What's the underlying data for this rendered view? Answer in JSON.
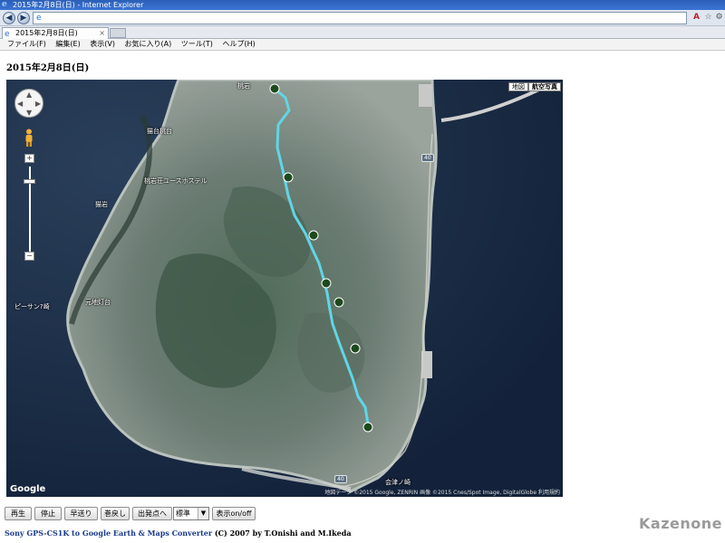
{
  "window": {
    "title": "2015年2月8日(日) - Internet Explorer"
  },
  "browser": {
    "icons": [
      "ie-logo",
      "back-icon",
      "forward-icon",
      "page-icon",
      "adobe-icon",
      "star-icon",
      "gear-icon"
    ],
    "tab_title": "2015年2月8日(日)",
    "tab_close": "×",
    "menu": [
      "ファイル(F)",
      "編集(E)",
      "表示(V)",
      "お気に入り(A)",
      "ツール(T)",
      "ヘルプ(H)"
    ]
  },
  "page": {
    "heading": "2015年2月8日(日)"
  },
  "map": {
    "map_type_buttons": [
      "地図",
      "航空写真"
    ],
    "selected_map_type": "航空写真",
    "zoom_in": "+",
    "zoom_out": "−",
    "places": [
      "桃岩",
      "猫台桃台",
      "桃岩荘ユースホステル",
      "猫岩",
      "元地灯台",
      "ピーサン?崎",
      "知床",
      "元地",
      "会津ノ崎"
    ],
    "route_badges": [
      "40",
      "40"
    ],
    "waypoint_count": 7,
    "google_logo": "Google",
    "copyright": "地図データ ©2015 Google, ZENRIN 画像 ©2015 Cnes/Spot Image, DigitalGlobe  利用規約",
    "colors": {
      "track": "#5fd6e6",
      "sea": "#16253a",
      "land": "#6c7d74"
    }
  },
  "controls": {
    "play": "再生",
    "stop": "停止",
    "fast_forward": "早送り",
    "rewind": "巻戻し",
    "to_start": "出発点へ",
    "speed_selected": "標準",
    "display_toggle": "表示on/off"
  },
  "footer": {
    "link_text": "Sony GPS-CS1K to Google Earth & Maps Converter",
    "credit": " (C) 2007 by T.Onishi and M.Ikeda"
  },
  "watermark": "Kazenone"
}
